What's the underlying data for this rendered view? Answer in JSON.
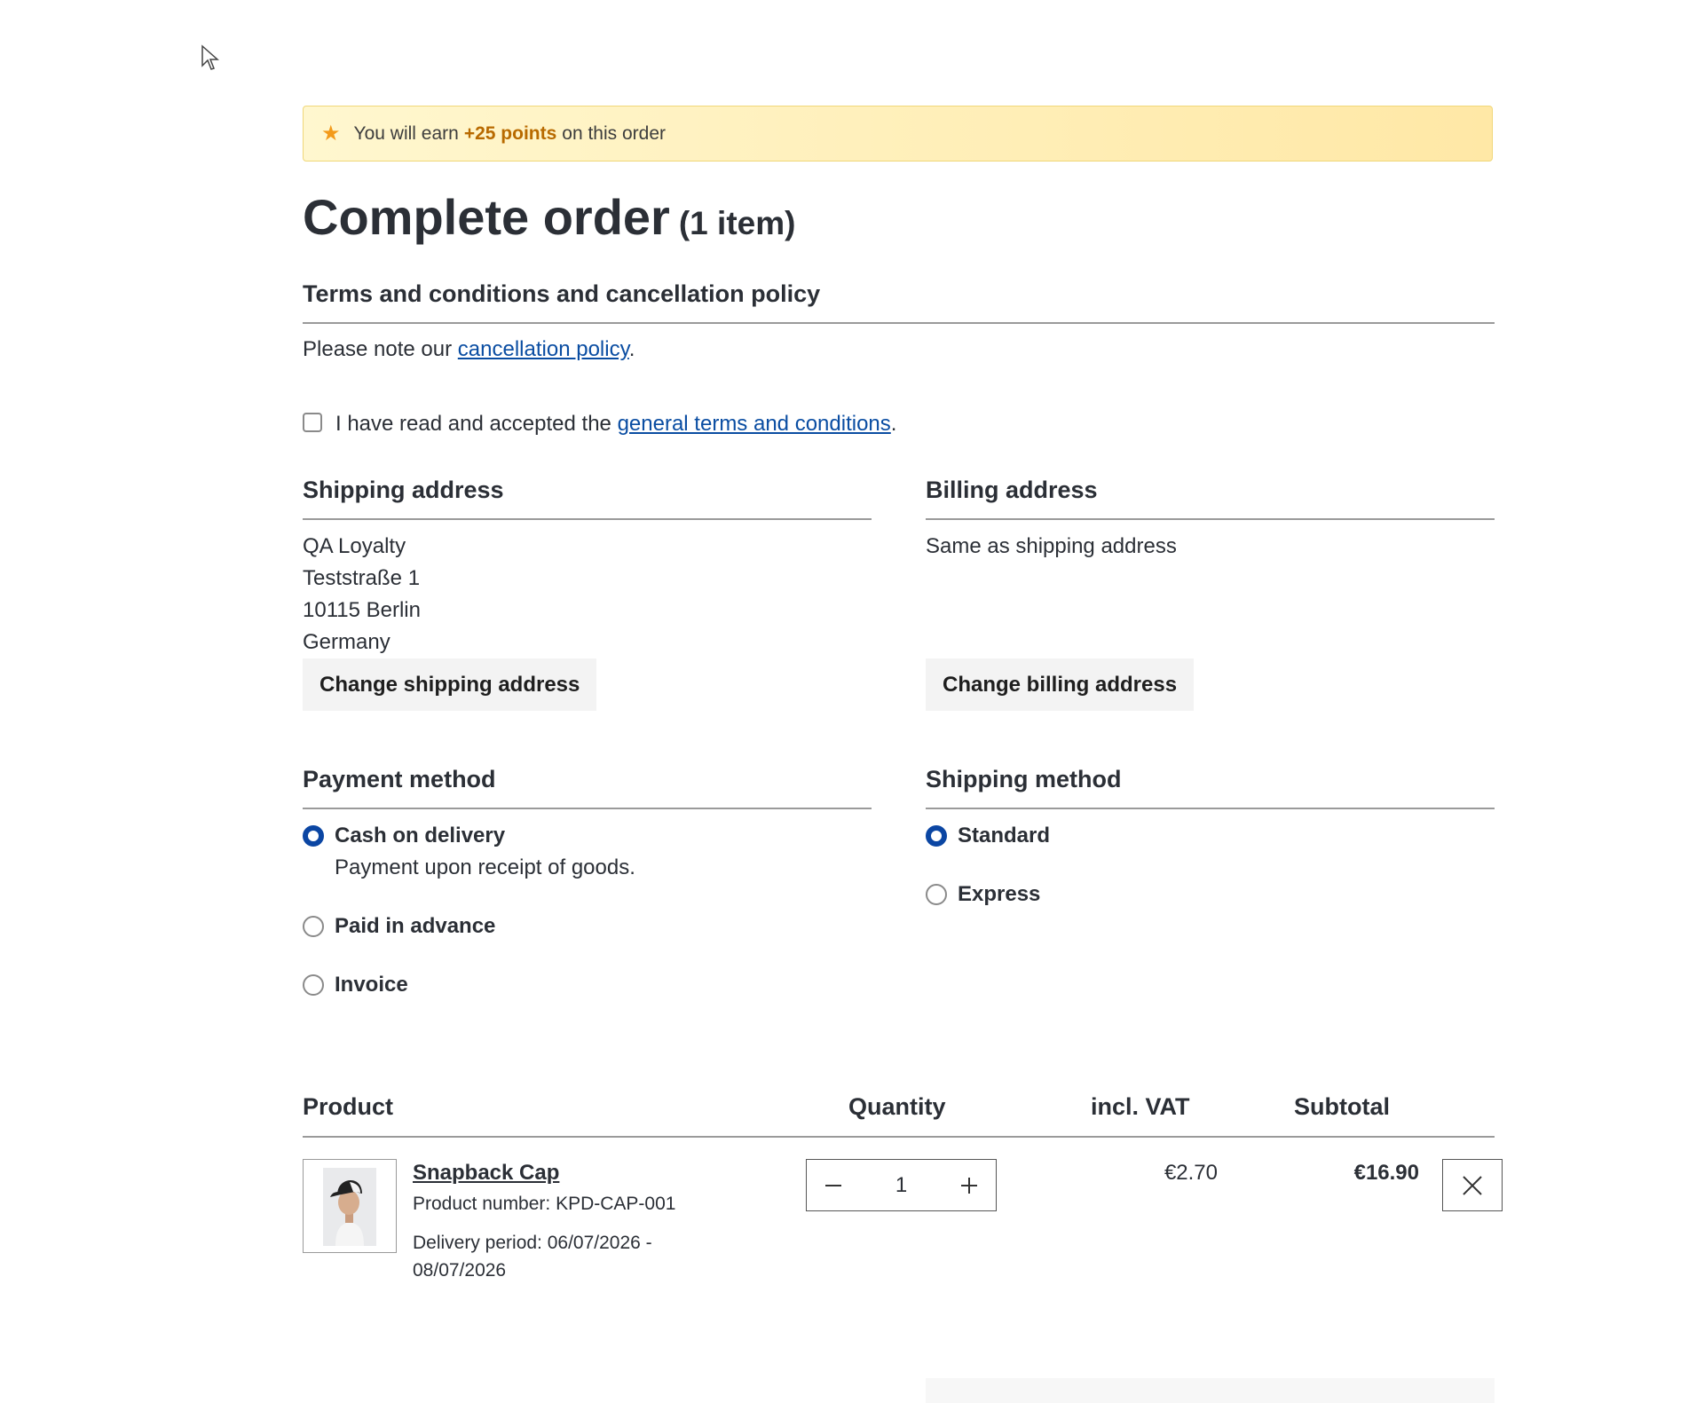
{
  "banner": {
    "prefix": "You will earn",
    "points": "+25 points",
    "suffix": "on this order"
  },
  "page": {
    "title": "Complete order",
    "item_count": "(1 item)"
  },
  "terms": {
    "heading": "Terms and conditions and cancellation policy",
    "note_prefix": "Please note our",
    "cancellation_link": "cancellation policy",
    "note_suffix": ".",
    "checkbox_prefix": "I have read and accepted the",
    "gtc_link": "general terms and conditions",
    "checkbox_suffix": ".",
    "accepted": false
  },
  "shipping_address": {
    "heading": "Shipping address",
    "lines": [
      "QA Loyalty",
      "Teststraße 1",
      "10115 Berlin",
      "Germany"
    ],
    "change_button": "Change shipping address"
  },
  "billing_address": {
    "heading": "Billing address",
    "text": "Same as shipping address",
    "change_button": "Change billing address"
  },
  "payment": {
    "heading": "Payment method",
    "options": [
      {
        "label": "Cash on delivery",
        "description": "Payment upon receipt of goods.",
        "selected": true
      },
      {
        "label": "Paid in advance",
        "selected": false
      },
      {
        "label": "Invoice",
        "selected": false
      }
    ]
  },
  "shipping_method": {
    "heading": "Shipping method",
    "options": [
      {
        "label": "Standard",
        "selected": true
      },
      {
        "label": "Express",
        "selected": false
      }
    ]
  },
  "table": {
    "headers": {
      "product": "Product",
      "quantity": "Quantity",
      "vat": "incl. VAT",
      "subtotal": "Subtotal"
    },
    "items": [
      {
        "name": "Snapback Cap",
        "product_number": "Product number: KPD-CAP-001",
        "delivery_line1": "Delivery period: 06/07/2026 -",
        "delivery_line2": "08/07/2026",
        "quantity": "1",
        "vat": "€2.70",
        "subtotal": "€16.90"
      }
    ]
  },
  "icons": {
    "banner": "star-icon",
    "qty_minus": "minus-icon",
    "qty_plus": "plus-icon",
    "remove": "close-icon",
    "cursor": "mouse-pointer-icon"
  },
  "colors": {
    "accent": "#0b46a3",
    "link": "#0a4da2",
    "points": "#b86a00",
    "star": "#f39a1a",
    "banner_bg": "#fff4c2"
  }
}
